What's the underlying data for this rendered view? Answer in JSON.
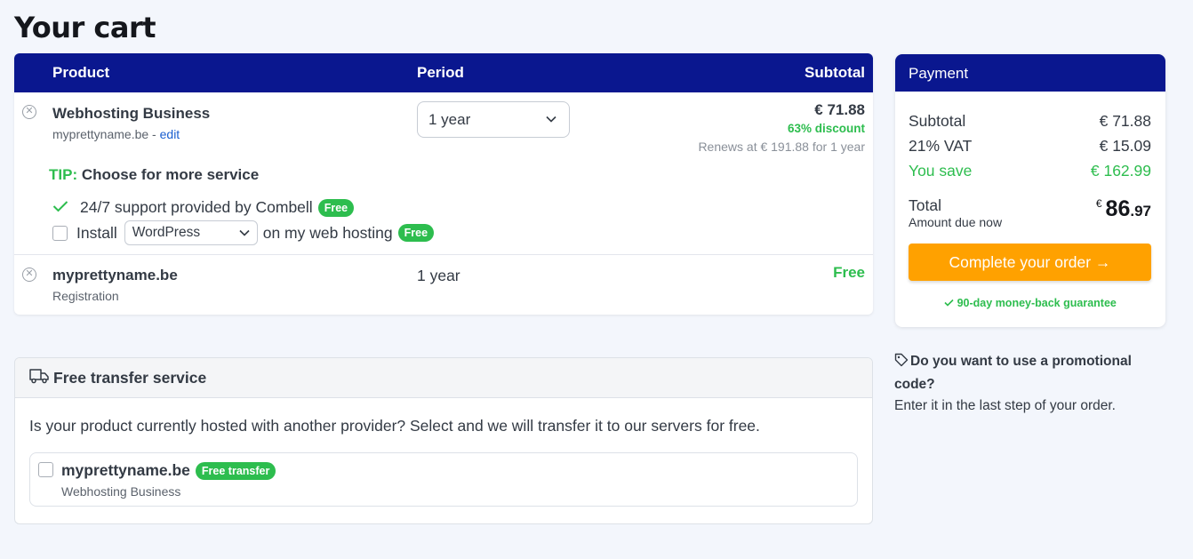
{
  "page": {
    "title": "Your cart"
  },
  "cart": {
    "headers": {
      "product": "Product",
      "period": "Period",
      "subtotal": "Subtotal"
    },
    "items": [
      {
        "name": "Webhosting Business",
        "domain": "myprettyname.be",
        "separator": " - ",
        "edit_link": "edit",
        "period": "1 year",
        "price": "€ 71.88",
        "discount": "63% discount",
        "renews": "Renews at € 191.88 for 1 year"
      },
      {
        "name": "myprettyname.be",
        "sub": "Registration",
        "period": "1 year",
        "price": "Free"
      }
    ],
    "tip": {
      "prefix": "TIP:",
      "text": " Choose for more service",
      "support": "24/7 support provided by Combell",
      "support_badge": "Free",
      "install_label": "Install",
      "install_select": "WordPress",
      "install_suffix": "on my web hosting",
      "install_badge": "Free"
    }
  },
  "payment": {
    "title": "Payment",
    "subtotal_label": "Subtotal",
    "subtotal_value": "€ 71.88",
    "vat_label": "21% VAT",
    "vat_value": "€ 15.09",
    "save_label": "You save",
    "save_value": "€ 162.99",
    "total_label": "Total",
    "total_sub": "Amount due now",
    "total_currency": "€",
    "total_int": "86",
    "total_cents": ".97",
    "order_button": "Complete your order →",
    "guarantee": "90-day money-back guarantee"
  },
  "promo": {
    "question": "Do you want to use a promotional code?",
    "answer": "Enter it in the last step of your order."
  },
  "transfer": {
    "title": "Free transfer service",
    "text": "Is your product currently hosted with another provider? Select and we will transfer it to our servers for free.",
    "item_name": "myprettyname.be",
    "item_badge": "Free transfer",
    "item_sub": "Webhosting Business"
  },
  "colors": {
    "brand": "#0a178f",
    "accent": "#ffa100",
    "success": "#2dbd4e"
  },
  "icons": [
    "remove-icon",
    "chevron-down-icon",
    "check-icon",
    "tag-icon",
    "truck-icon"
  ]
}
